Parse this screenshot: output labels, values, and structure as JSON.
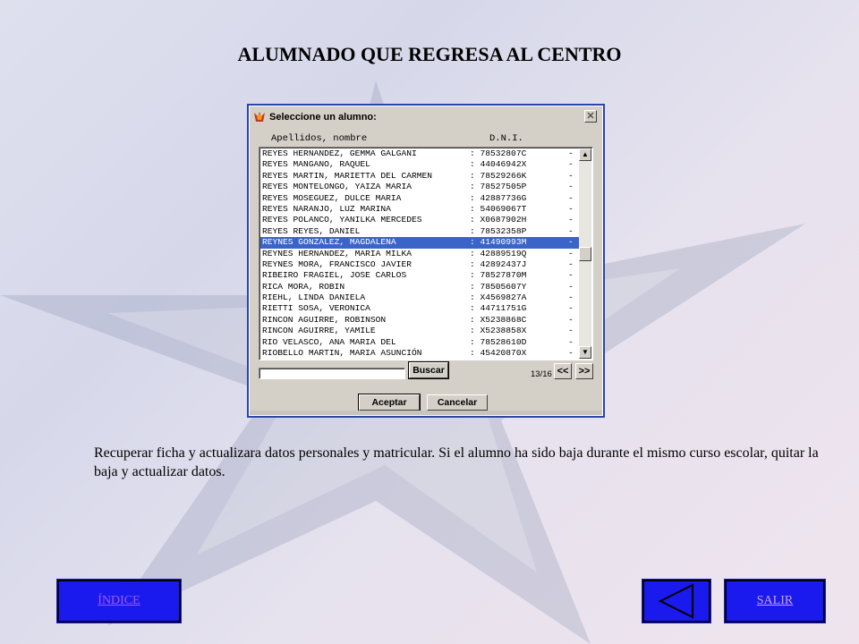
{
  "page": {
    "title": "ALUMNADO QUE REGRESA AL CENTRO"
  },
  "dialog": {
    "title": "Seleccione un alumno:",
    "close_glyph": "✕",
    "columns": {
      "name": "Apellidos, nombre",
      "dni": "D.N.I."
    },
    "rows": [
      {
        "name": "REYES HERNANDEZ, GEMMA GALGANI",
        "dni": ": 78532807C",
        "mark": "-"
      },
      {
        "name": "REYES MANGANO, RAQUEL",
        "dni": ": 44046942X",
        "mark": "-"
      },
      {
        "name": "REYES MARTIN, MARIETTA DEL CARMEN",
        "dni": ": 78529266K",
        "mark": "-"
      },
      {
        "name": "REYES MONTELONGO, YAIZA MARIA",
        "dni": ": 78527505P",
        "mark": "-"
      },
      {
        "name": "REYES MOSEGUEZ, DULCE MARIA",
        "dni": ": 42887736G",
        "mark": "-"
      },
      {
        "name": "REYES NARANJO, LUZ MARINA",
        "dni": ": 54069067T",
        "mark": "-"
      },
      {
        "name": "REYES POLANCO, YANILKA MERCEDES",
        "dni": ": X0687902H",
        "mark": "-"
      },
      {
        "name": "REYES REYES, DANIEL",
        "dni": ": 78532358P",
        "mark": "-"
      },
      {
        "name": "REYNES GONZALEZ, MAGDALENA",
        "dni": ": 41490993M",
        "mark": "-",
        "selected": true
      },
      {
        "name": "REYNES HERNANDEZ, MARIA MILKA",
        "dni": ": 42889519Q",
        "mark": "-"
      },
      {
        "name": "REYNES MORA, FRANCISCO JAVIER",
        "dni": ": 42892437J",
        "mark": "-"
      },
      {
        "name": "RIBEIRO FRAGIEL, JOSE CARLOS",
        "dni": ": 78527870M",
        "mark": "-"
      },
      {
        "name": "RICA MORA, ROBIN",
        "dni": ": 78505607Y",
        "mark": "-"
      },
      {
        "name": "RIEHL, LINDA DANIELA",
        "dni": ": X4569827A",
        "mark": "-"
      },
      {
        "name": "RIETTI SOSA, VERONICA",
        "dni": ": 44711751G",
        "mark": "-"
      },
      {
        "name": "RINCON AGUIRRE, ROBINSON",
        "dni": ": X5238868C",
        "mark": "-"
      },
      {
        "name": "RINCON AGUIRRE, YAMILE",
        "dni": ": X5238858X",
        "mark": "-"
      },
      {
        "name": "RIO VELASCO, ANA MARIA DEL",
        "dni": ": 78528610D",
        "mark": "-"
      },
      {
        "name": "RIOBELLO MARTIN, MARIA ASUNCIÓN",
        "dni": ": 45420870X",
        "mark": "-"
      }
    ],
    "scroll_position": 0.5,
    "search": {
      "value": "",
      "button": "Buscar"
    },
    "page_indicator": "13/16",
    "prev_label": "<<",
    "next_label": ">>",
    "accept_label": "Aceptar",
    "cancel_label": "Cancelar"
  },
  "description": "Recuperar ficha y actualizara datos personales y matricular. Si el alumno ha sido baja durante el mismo curso escolar, quitar la baja y actualizar datos.",
  "nav": {
    "indice_label": "ÍNDICE",
    "salir_label": "SALIR",
    "back_icon": "triangle-left-icon"
  },
  "colors": {
    "nav_blue": "#1a1aee",
    "selection": "#3a64c8",
    "dialog_frame": "#2c46a8"
  }
}
